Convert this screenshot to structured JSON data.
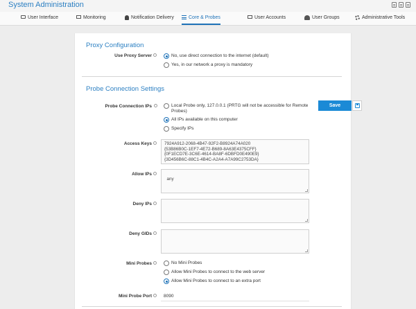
{
  "header": {
    "title": "System Administration"
  },
  "tabs": [
    {
      "label": "User Interface",
      "icon": "monitor-icon"
    },
    {
      "label": "Monitoring",
      "icon": "laptop-icon"
    },
    {
      "label": "Notification Delivery",
      "icon": "bell-icon"
    },
    {
      "label": "Core & Probes",
      "icon": "sliders-icon",
      "active": true
    },
    {
      "label": "User Accounts",
      "icon": "id-card-icon"
    },
    {
      "label": "User Groups",
      "icon": "users-icon"
    },
    {
      "label": "Administrative Tools",
      "icon": "gears-icon"
    }
  ],
  "proxy": {
    "section_title": "Proxy Configuration",
    "label": "Use Proxy Server",
    "options": [
      {
        "text": "No, use direct connection to the internet (default)",
        "selected": true
      },
      {
        "text": "Yes, in our network a proxy is mandatory",
        "selected": false
      }
    ]
  },
  "probe": {
    "section_title": "Probe Connection Settings",
    "connection_ips": {
      "label": "Probe Connection IPs",
      "options": [
        {
          "text": "Local Probe only, 127.0.0.1 (PRTG will not be accessible for Remote Probes)",
          "selected": false
        },
        {
          "text": "All IPs available on this computer",
          "selected": true
        },
        {
          "text": "Specify IPs",
          "selected": false
        }
      ]
    },
    "access_keys": {
      "label": "Access Keys",
      "value": "7924A912-2068-4B47-92F2-B8924A74A020\n{53B86B0C-1EF7-4E72-B689-8A63E4375CFF}\n{0F1ECD7E-3C6E-4614-BA8F-6DBFD0E490E9}\n{3D456B6C-88C1-4B4C-A2A4-A7A99C2753DA}"
    },
    "allow_ips": {
      "label": "Allow IPs",
      "value": "any"
    },
    "deny_ips": {
      "label": "Deny IPs",
      "value": ""
    },
    "deny_gids": {
      "label": "Deny GIDs",
      "value": ""
    },
    "mini_probes": {
      "label": "Mini Probes",
      "options": [
        {
          "text": "No Mini Probes",
          "selected": false
        },
        {
          "text": "Allow Mini Probes to connect to the web server",
          "selected": false
        },
        {
          "text": "Allow Mini Probes to connect to an extra port",
          "selected": true
        }
      ]
    },
    "mini_probe_port": {
      "label": "Mini Probe Port",
      "value": "8090"
    }
  },
  "actions": {
    "save_label": "Save",
    "save_icon": "floppy-disk-icon"
  },
  "colors": {
    "accent": "#2b7fc2",
    "button": "#1b8ad6"
  }
}
